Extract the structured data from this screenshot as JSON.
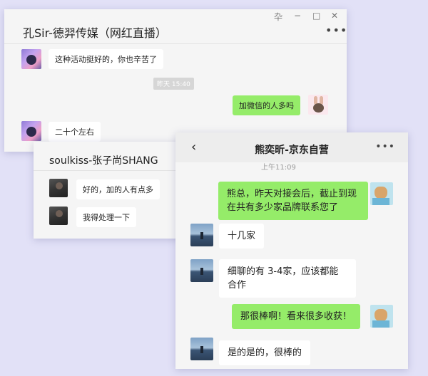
{
  "window1": {
    "title": "孔Sir-德羿传媒（网红直播）",
    "controls": {
      "pin": "卆",
      "minimize": "−",
      "maximize": "□",
      "close": "✕"
    },
    "more": "•••",
    "messages": [
      {
        "side": "left",
        "text": "这种活动挺好的，你也辛苦了",
        "avatar": "anime-avatar"
      },
      {
        "type": "timestamp",
        "text": "昨天 15:40"
      },
      {
        "side": "right",
        "text": "加微信的人多吗",
        "avatar": "bunny-avatar"
      },
      {
        "side": "left",
        "text": "二十个左右",
        "avatar": "anime-avatar"
      }
    ]
  },
  "window2": {
    "title": "soulkiss-张子尚SHANG",
    "messages": [
      {
        "side": "left",
        "text": "好的，加的人有点多"
      },
      {
        "side": "left",
        "text": "我得处理一下"
      }
    ]
  },
  "window3": {
    "title": "熊奕昕-京东自营",
    "back_icon": "‹",
    "more": "•••",
    "partial_timestamp": "上午11:09",
    "messages": [
      {
        "side": "right",
        "text": "熊总，昨天对接会后，截止到现在共有多少家品牌联系您了"
      },
      {
        "side": "left",
        "text": "十几家"
      },
      {
        "side": "left",
        "text": "细聊的有 3-4家，应该都能合作"
      },
      {
        "side": "right",
        "text": "那很棒啊！看来很多收获！"
      },
      {
        "side": "left",
        "text": "是的是的，很棒的"
      }
    ]
  },
  "colors": {
    "green_bubble": "#95ec69",
    "white_bubble": "#ffffff",
    "background": "#e2e1f7"
  }
}
